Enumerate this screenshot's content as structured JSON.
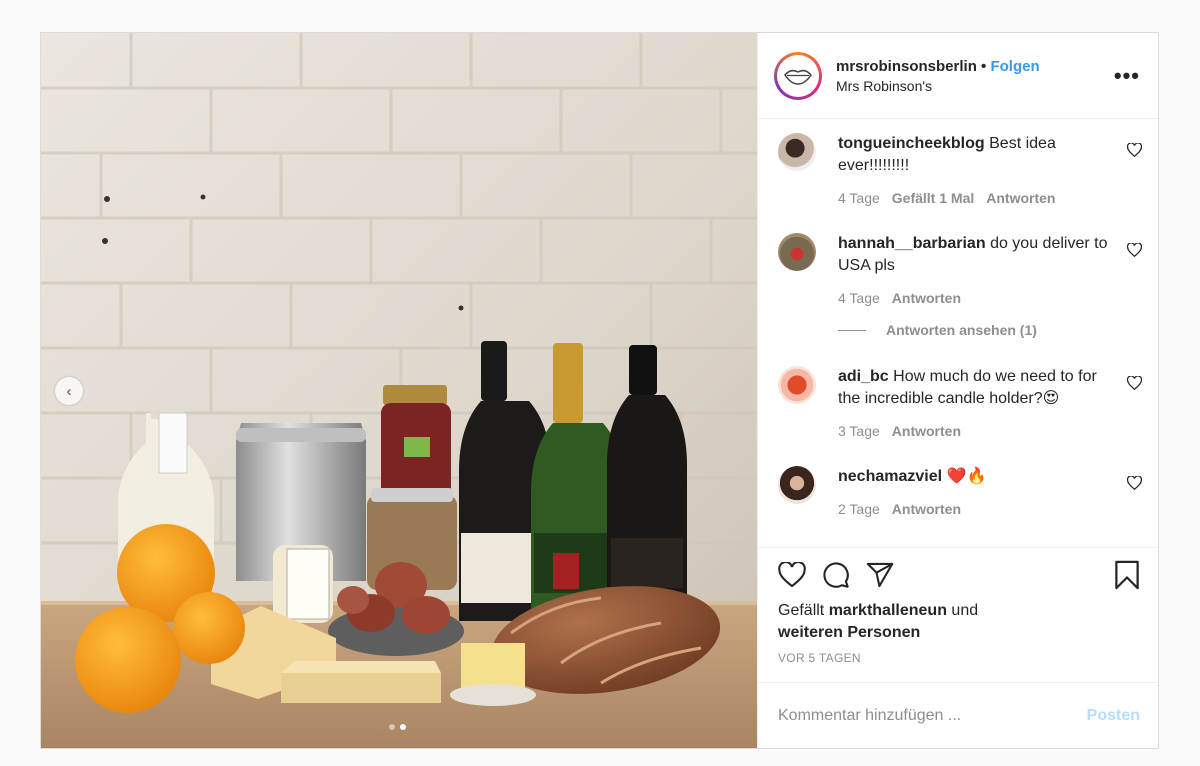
{
  "post": {
    "username": "mrsrobinsonsberlin",
    "separator": "•",
    "follow_label": "Folgen",
    "location": "Mrs Robinson's",
    "more_label": "•••",
    "photo_alt": "Brot, Käse, Eier, Champagner und Orangen vor weißer Ziegelwand",
    "photo_prev": "‹"
  },
  "comments": [
    {
      "user": "tongueincheekblog",
      "text": "Best idea ever!!!!!!!!!",
      "time": "4 Tage",
      "likes": "Gefällt 1 Mal",
      "reply": "Antworten"
    },
    {
      "user": "hannah__barbarian",
      "text": "do you deliver to USA pls",
      "time": "4 Tage",
      "likes": "",
      "reply": "Antworten"
    },
    {
      "user": "adi_bc",
      "text": "How much do we need to for the incredible candle holder?😍",
      "time": "3 Tage",
      "likes": "",
      "reply": "Antworten"
    },
    {
      "user": "nechamazviel",
      "text": "❤️🔥",
      "time": "2 Tage",
      "likes": "",
      "reply": "Antworten"
    }
  ],
  "view_replies": "Antworten ansehen (1)",
  "likes": {
    "prefix": "Gefällt",
    "user": "markthalleneun",
    "connector": "und",
    "others": "weiteren Personen"
  },
  "date": "VOR 5 TAGEN",
  "add_comment": {
    "placeholder": "Kommentar hinzufügen ...",
    "post_label": "Posten"
  },
  "icons": [
    "heart-icon",
    "comment-icon",
    "share-icon",
    "bookmark-icon",
    "more-icon",
    "chevron-left-icon"
  ],
  "colors": {
    "follow": "#3897f0",
    "post_disabled": "#b2dffc",
    "meta": "#8e8e8e",
    "text": "#262626"
  }
}
